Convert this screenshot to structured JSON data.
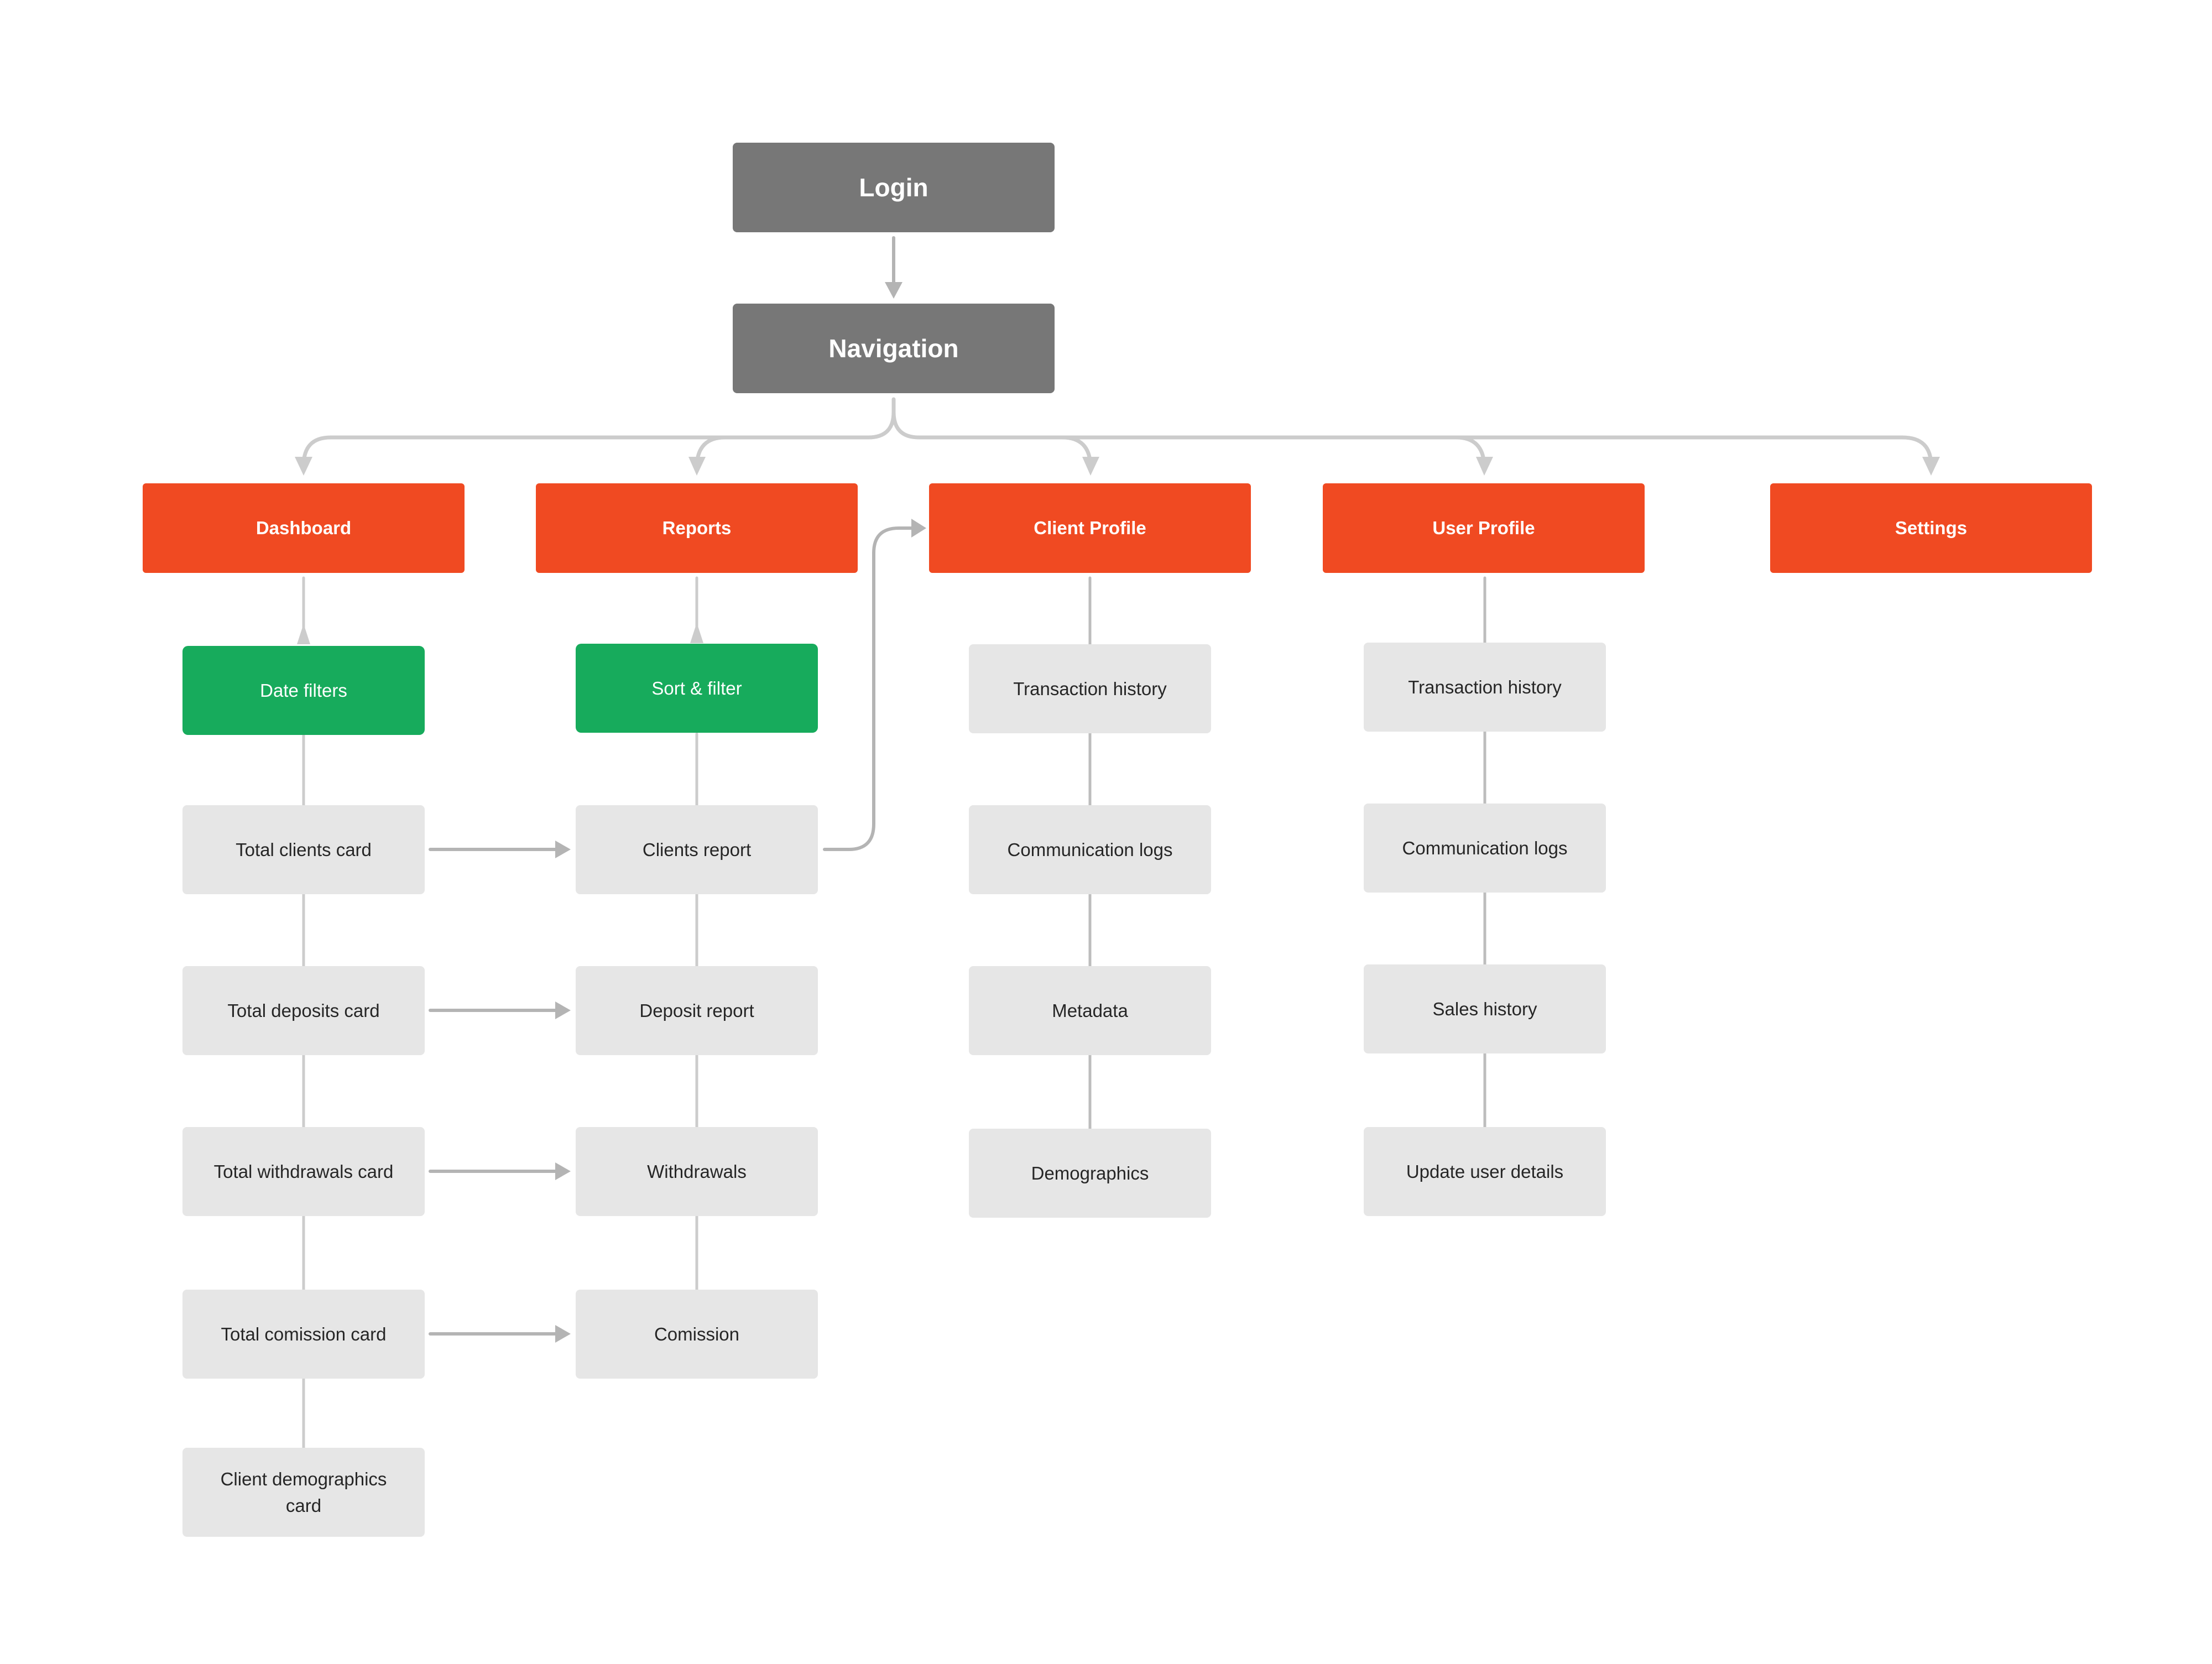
{
  "diagram": {
    "colors": {
      "root_node": "#777777",
      "section_node": "#f04a22",
      "filter_node": "#17ab5c",
      "leaf_node": "#e6e6e6",
      "connector": "#c8c8c8",
      "connector_dark": "#b4b4b4"
    },
    "root": {
      "login": "Login",
      "navigation": "Navigation"
    },
    "sections": [
      {
        "label": "Dashboard"
      },
      {
        "label": "Reports"
      },
      {
        "label": "Client Profile"
      },
      {
        "label": "User Profile"
      },
      {
        "label": "Settings"
      }
    ],
    "dashboard": {
      "filter": "Date filters",
      "items": [
        "Total clients card",
        "Total deposits card",
        "Total withdrawals card",
        "Total comission card",
        "Client demographics card"
      ]
    },
    "reports": {
      "filter": "Sort & filter",
      "items": [
        "Clients report",
        "Deposit report",
        "Withdrawals",
        "Comission"
      ]
    },
    "client_profile": {
      "items": [
        "Transaction history",
        "Communication logs",
        "Metadata",
        "Demographics"
      ]
    },
    "user_profile": {
      "items": [
        "Transaction history",
        "Communication logs",
        "Sales history",
        "Update user details"
      ]
    },
    "edges": [
      {
        "from": "Login",
        "to": "Navigation",
        "type": "arrow"
      },
      {
        "from": "Navigation",
        "to": "Dashboard",
        "type": "arrow"
      },
      {
        "from": "Navigation",
        "to": "Reports",
        "type": "arrow"
      },
      {
        "from": "Navigation",
        "to": "Client Profile",
        "type": "arrow"
      },
      {
        "from": "Navigation",
        "to": "User Profile",
        "type": "arrow"
      },
      {
        "from": "Navigation",
        "to": "Settings",
        "type": "arrow"
      },
      {
        "from": "Date filters",
        "to": "Dashboard",
        "type": "arrow"
      },
      {
        "from": "Sort & filter",
        "to": "Reports",
        "type": "arrow"
      },
      {
        "from": "Total clients card",
        "to": "Clients report",
        "type": "arrow"
      },
      {
        "from": "Total deposits card",
        "to": "Deposit report",
        "type": "arrow"
      },
      {
        "from": "Total withdrawals card",
        "to": "Withdrawals",
        "type": "arrow"
      },
      {
        "from": "Total comission card",
        "to": "Comission",
        "type": "arrow"
      },
      {
        "from": "Clients report",
        "to": "Client Profile",
        "type": "arrow"
      }
    ]
  }
}
